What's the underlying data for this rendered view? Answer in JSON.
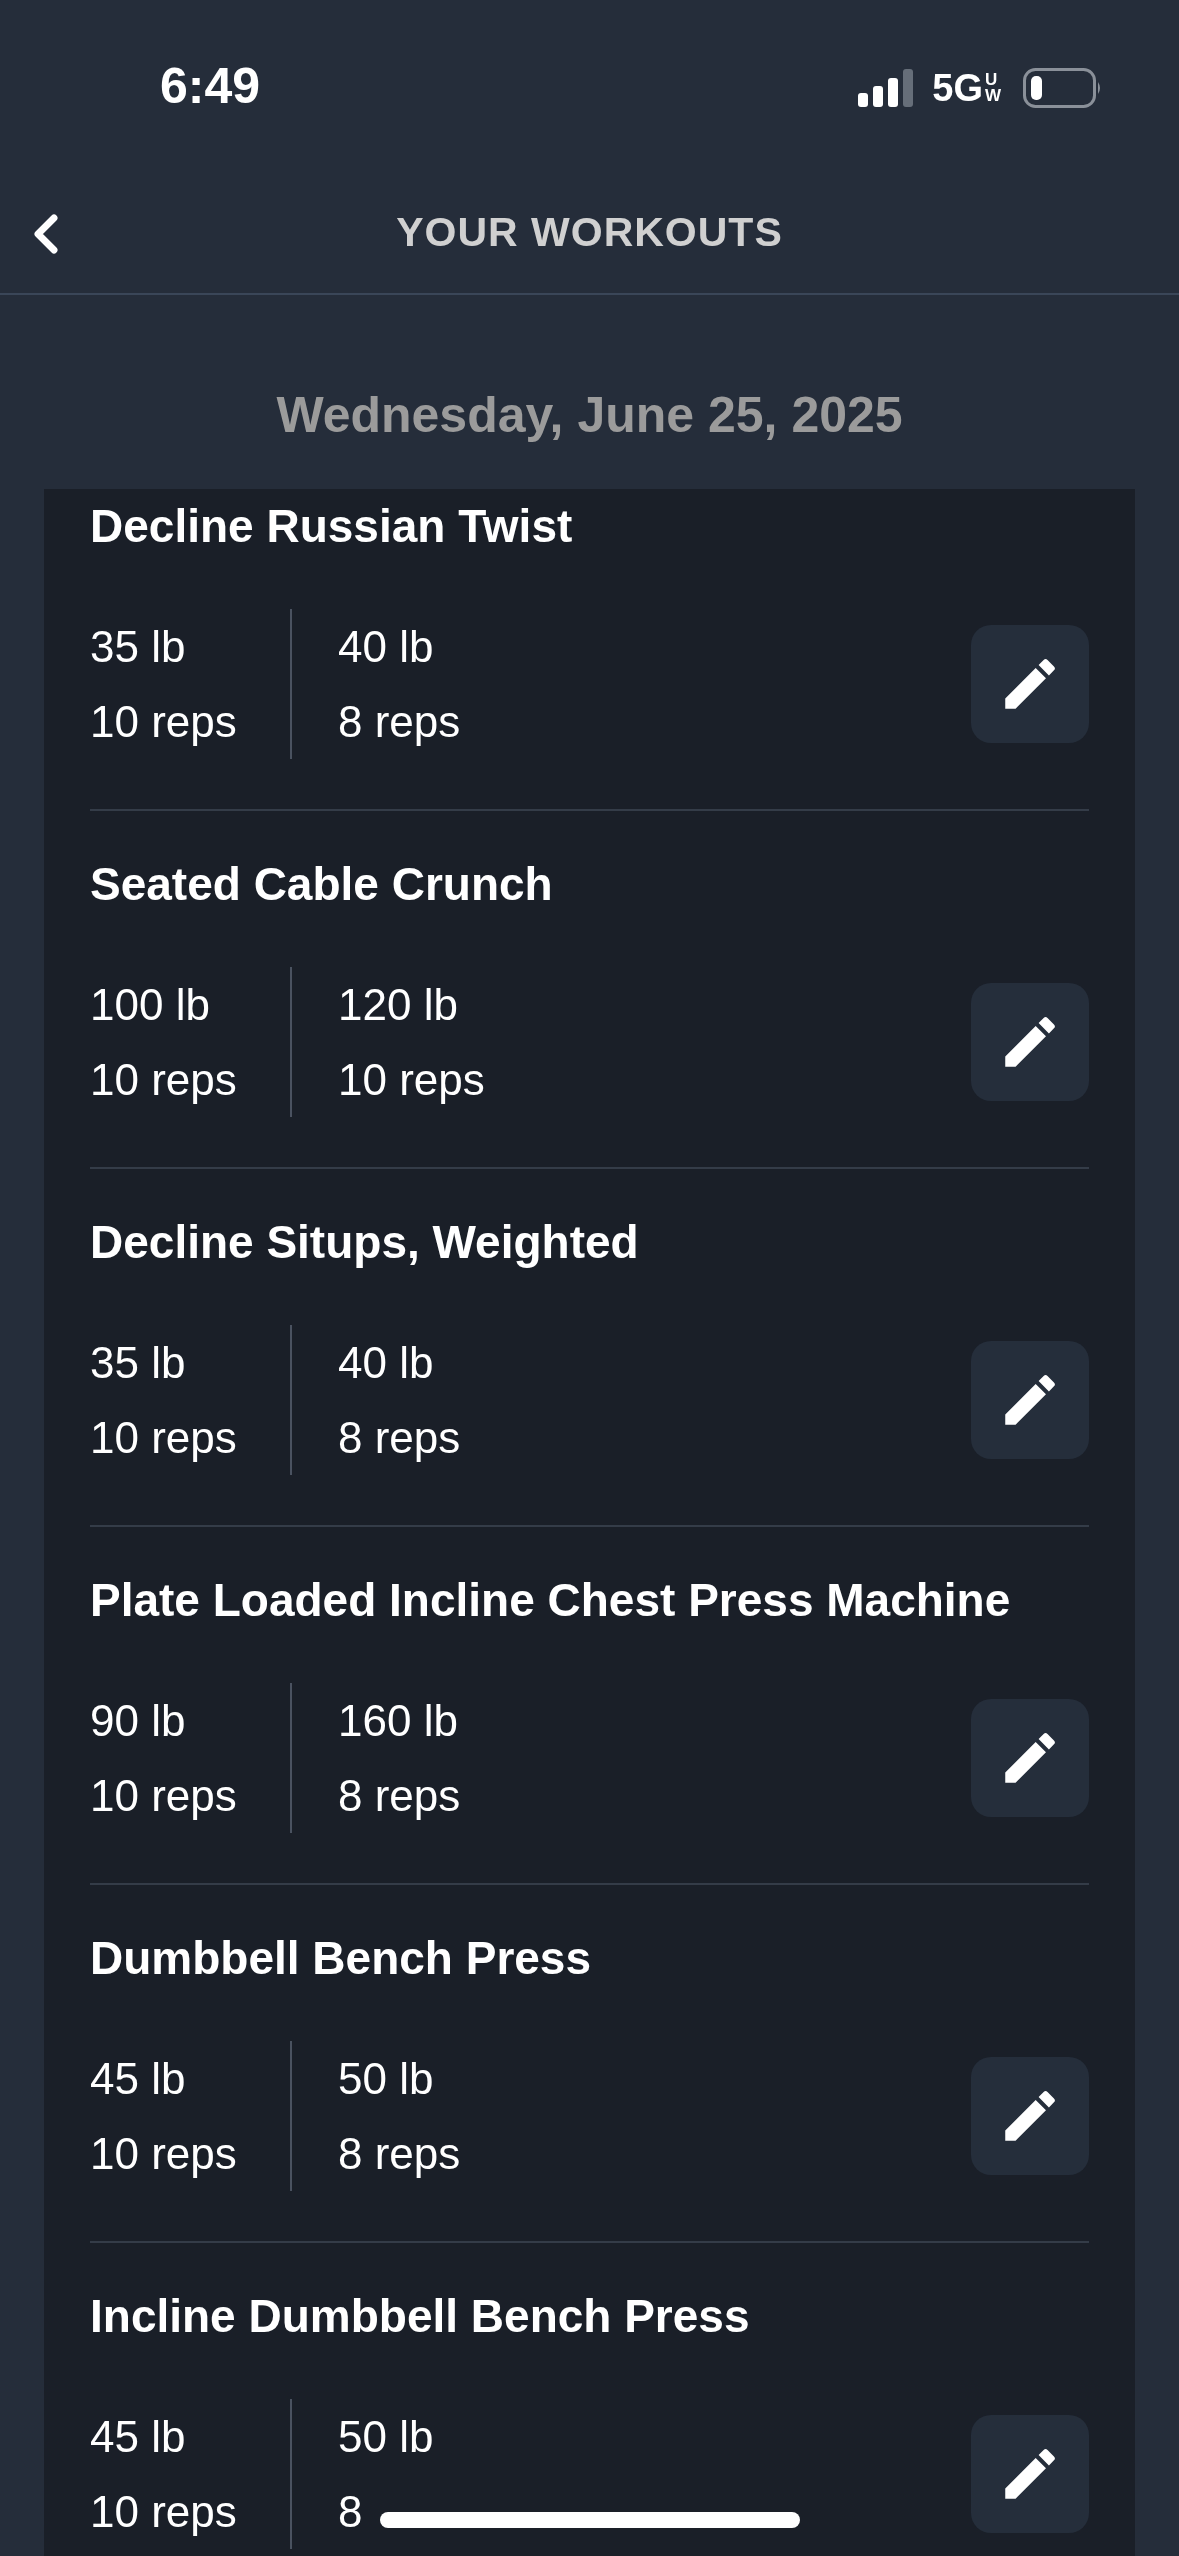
{
  "status_bar": {
    "time": "6:49",
    "network": "5G",
    "network_sub": "UW"
  },
  "nav": {
    "title": "YOUR WORKOUTS"
  },
  "date": "Wednesday, June 25, 2025",
  "exercises": [
    {
      "name": "Decline Russian Twist",
      "sets": [
        {
          "weight": "35 lb",
          "reps": "10 reps"
        },
        {
          "weight": "40 lb",
          "reps": "8 reps"
        }
      ]
    },
    {
      "name": "Seated Cable Crunch",
      "sets": [
        {
          "weight": "100 lb",
          "reps": "10 reps"
        },
        {
          "weight": "120 lb",
          "reps": "10 reps"
        }
      ]
    },
    {
      "name": "Decline Situps, Weighted",
      "sets": [
        {
          "weight": "35 lb",
          "reps": "10 reps"
        },
        {
          "weight": "40 lb",
          "reps": "8 reps"
        }
      ]
    },
    {
      "name": "Plate Loaded Incline Chest Press Machine",
      "sets": [
        {
          "weight": "90 lb",
          "reps": "10 reps"
        },
        {
          "weight": "160 lb",
          "reps": "8 reps"
        }
      ]
    },
    {
      "name": "Dumbbell Bench Press",
      "sets": [
        {
          "weight": "45 lb",
          "reps": "10 reps"
        },
        {
          "weight": "50 lb",
          "reps": "8 reps"
        }
      ]
    },
    {
      "name": "Incline Dumbbell Bench Press",
      "sets": [
        {
          "weight": "45 lb",
          "reps": "10 reps"
        },
        {
          "weight": "50 lb",
          "reps": "8"
        }
      ]
    }
  ]
}
